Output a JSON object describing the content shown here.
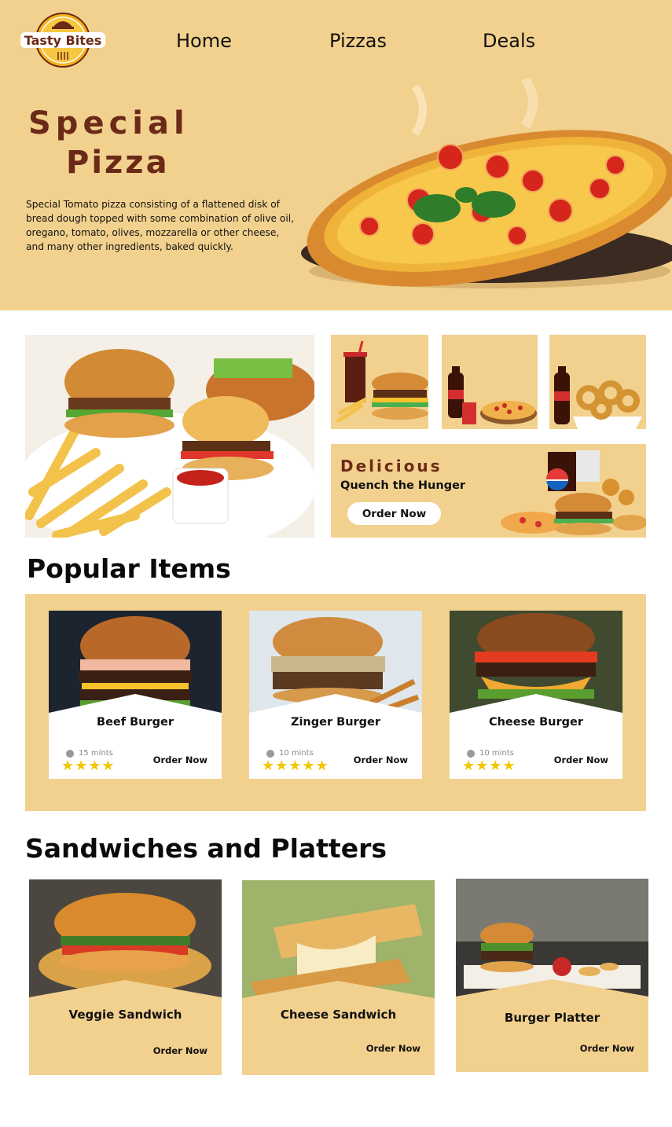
{
  "brand": {
    "name": "Tasty Bites"
  },
  "nav": {
    "home": "Home",
    "pizzas": "Pizzas",
    "deals": "Deals"
  },
  "hero": {
    "title_line1": "Special",
    "title_line2": "Pizza",
    "description": "Special Tomato pizza consisting of a flattened disk of bread dough topped with some combination of olive oil, oregano, tomato, olives, mozzarella or other cheese, and many other ingredients, baked quickly."
  },
  "banner": {
    "title": "Delicious",
    "subtitle": "Quench the Hunger",
    "button": "Order Now"
  },
  "popular": {
    "title": "Popular Items",
    "items": [
      {
        "name": "Beef Burger",
        "time": "15 mints",
        "stars": "★★★★",
        "order": "Order Now"
      },
      {
        "name": "Zinger Burger",
        "time": "10 mints",
        "stars": "★★★★★",
        "order": "Order Now"
      },
      {
        "name": "Cheese Burger",
        "time": "10 mints",
        "stars": "★★★★",
        "order": "Order Now"
      }
    ]
  },
  "sandwiches": {
    "title": "Sandwiches and Platters",
    "items": [
      {
        "name": "Veggie Sandwich",
        "order": "Order Now"
      },
      {
        "name": "Cheese Sandwich",
        "order": "Order Now"
      },
      {
        "name": "Burger Platter",
        "order": "Order Now"
      }
    ]
  },
  "colors": {
    "background_accent": "#f2d18e",
    "brand_brown": "#6b2a17",
    "star": "#f2c600"
  }
}
